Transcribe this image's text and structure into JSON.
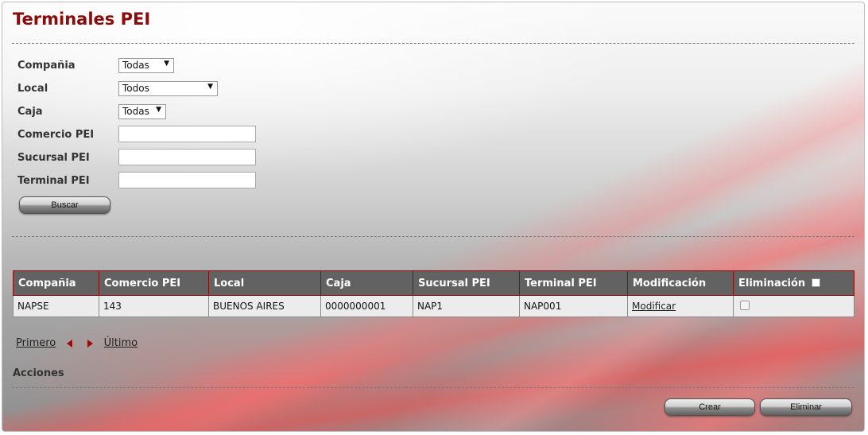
{
  "page": {
    "title": "Terminales PEI"
  },
  "form": {
    "compania": {
      "label": "Compañia",
      "value": "Todas"
    },
    "local": {
      "label": "Local",
      "value": "Todos"
    },
    "caja": {
      "label": "Caja",
      "value": "Todas"
    },
    "comercio_pei": {
      "label": "Comercio PEI",
      "value": ""
    },
    "sucursal_pei": {
      "label": "Sucursal PEI",
      "value": ""
    },
    "terminal_pei": {
      "label": "Terminal PEI",
      "value": ""
    },
    "search_label": "Buscar"
  },
  "table": {
    "headers": [
      "Compañia",
      "Comercio PEI",
      "Local",
      "Caja",
      "Sucursal PEI",
      "Terminal PEI",
      "Modificación",
      "Eliminación"
    ],
    "rows": [
      [
        "NAPSE",
        "143",
        "BUENOS AIRES",
        "0000000001",
        "NAP1",
        "NAP001",
        "Modificar",
        ""
      ]
    ]
  },
  "pager": {
    "first": "Primero",
    "last": "Último"
  },
  "actions": {
    "label": "Acciones",
    "create_label": "Crear",
    "delete_label": "Eliminar"
  },
  "colors": {
    "title": "#8a0b0b",
    "table_header": "#626262",
    "pager_arrow": "#9a0c0c"
  }
}
